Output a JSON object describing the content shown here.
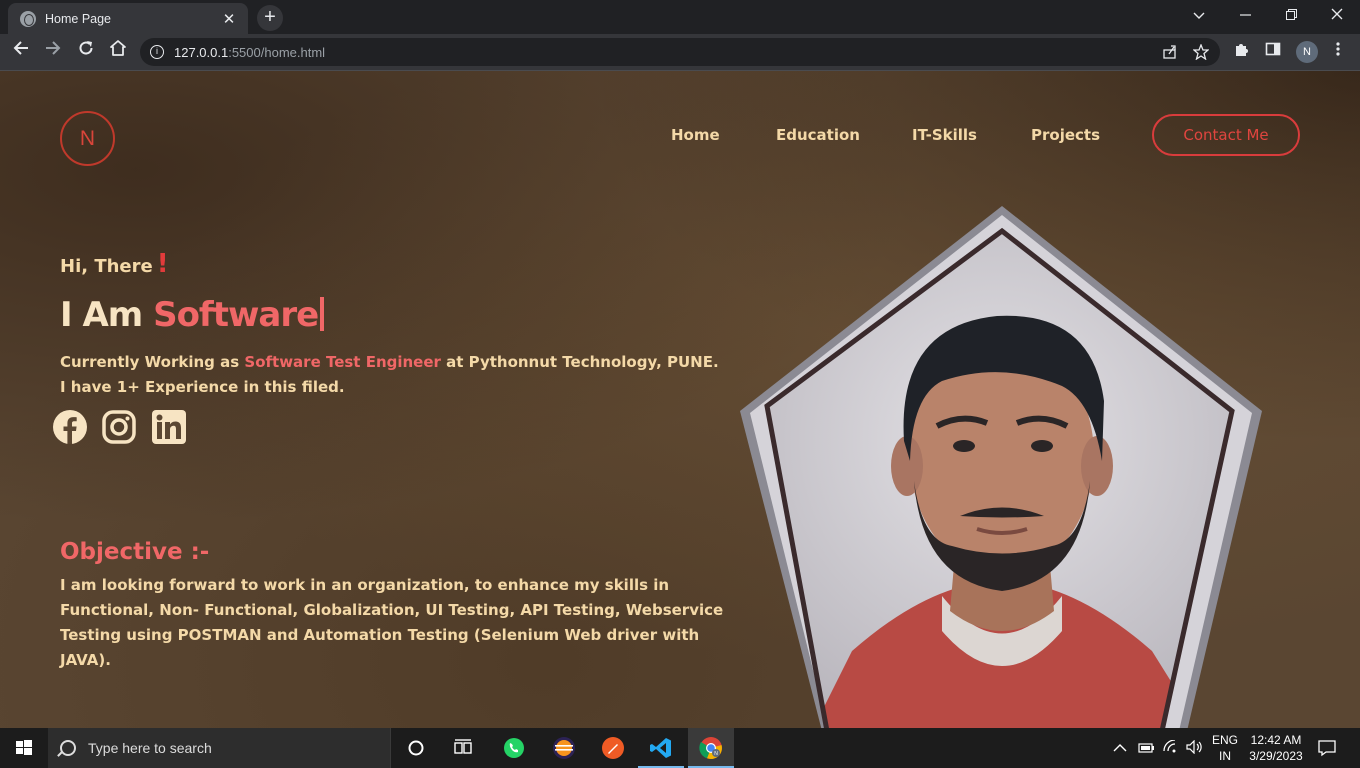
{
  "browser": {
    "tab_title": "Home Page",
    "tab_close": "✕",
    "new_tab": "+",
    "url_host": "127.0.0.1",
    "url_rest": ":5500/home.html",
    "profile_initial": "N"
  },
  "site": {
    "logo": "N",
    "nav": [
      "Home",
      "Education",
      "IT-Skills",
      "Projects"
    ],
    "contact_button": "Contact Me",
    "greeting": "Hi, There",
    "greeting_mark": "!",
    "headline_prefix": "I Am",
    "headline_typed": "Software",
    "bio_line1_before": "Currently Working as ",
    "bio_line1_highlight": "Software Test Engineer",
    "bio_line1_after": " at Pythonnut Technology, PUNE.",
    "bio_line2": "I have 1+ Experience in this filed.",
    "social_icons": [
      "facebook-icon",
      "instagram-icon",
      "linkedin-icon"
    ],
    "objective_title": "Objective :-",
    "objective_text": "I am looking forward to work in an organization, to enhance my skills in Functional, Non- Functional, Globalization, UI Testing, API Testing, Webservice Testing using POSTMAN and Automation Testing (Selenium Web driver with JAVA)."
  },
  "taskbar": {
    "search_placeholder": "Type here to search",
    "language": "ENG",
    "region": "IN",
    "time": "12:42 AM",
    "date": "3/29/2023"
  },
  "colors": {
    "accent_red": "#f06767",
    "text_cream": "#f4d9a8",
    "page_bg": "#5a4632"
  }
}
